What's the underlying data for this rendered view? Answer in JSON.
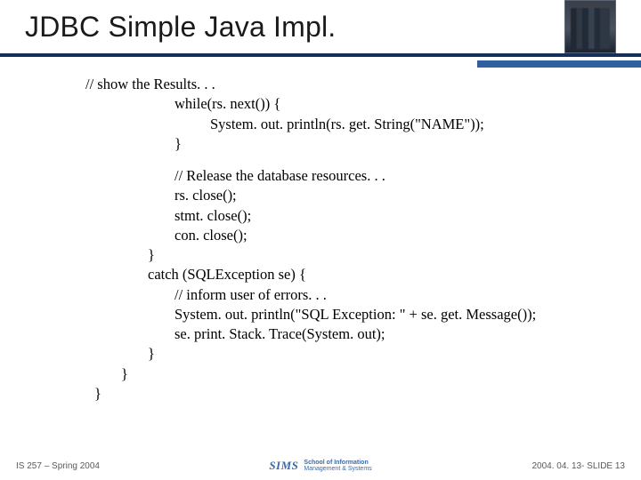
{
  "title": "JDBC Simple Java Impl.",
  "code": {
    "comment1": "// show the Results. . .",
    "while": "while(rs. next()) {",
    "println1": "System. out. println(rs. get. String(\"NAME\"));",
    "brace1": "}",
    "comment2": "// Release the database resources. . .",
    "rsclose": "rs. close();",
    "stmtclose": "stmt. close();",
    "conclose": "con. close();",
    "brace2": "}",
    "catch": "catch (SQLException se) {",
    "comment3": "// inform user of errors. . .",
    "println2": "System. out. println(\"SQL Exception: \" + se. get. Message());",
    "printstack": "se. print. Stack. Trace(System. out);",
    "brace3": "}",
    "brace4": "}",
    "brace5": "}"
  },
  "footer": {
    "left": "IS 257 – Spring 2004",
    "right": "2004. 04. 13- SLIDE 13",
    "logo": "SIMS",
    "logosub1": "School of Information",
    "logosub2": "Management & Systems"
  }
}
